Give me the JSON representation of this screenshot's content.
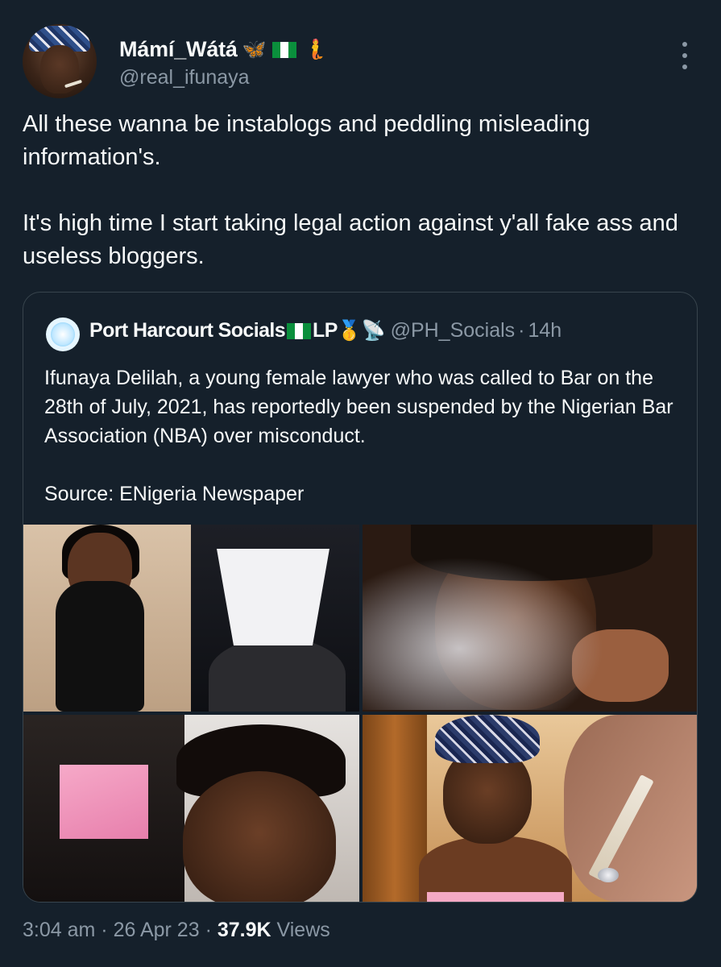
{
  "author": {
    "display_name": "Mámí_Wátá",
    "name_emojis": [
      "🦋",
      "🇳🇬",
      "🧜"
    ],
    "handle": "@real_ifunaya"
  },
  "tweet": {
    "text": "All these wanna be instablogs and peddling misleading information's.\n\nIt's high time I start taking legal action against y'all fake ass and useless bloggers."
  },
  "quoted_tweet": {
    "display_name": "Port Harcourt Socials",
    "name_suffix": "LP",
    "name_emojis": [
      "🥇",
      "📡"
    ],
    "handle": "@PH_Socials",
    "separator": "·",
    "time": "14h",
    "text": "Ifunaya Delilah, a young female lawyer who was called to Bar on the 28th of July, 2021, has reportedly been suspended by the Nigerian Bar Association (NBA) over misconduct.\n\nSource: ENigeria Newspaper",
    "photos": [
      "photo-1",
      "photo-2",
      "photo-3",
      "photo-4"
    ]
  },
  "meta": {
    "time": "3:04 am",
    "sep1": "·",
    "date": "26 Apr 23",
    "sep2": "·",
    "views_count": "37.9K",
    "views_label": "Views"
  },
  "colors": {
    "background": "#15202b",
    "text_primary": "#f7f9f9",
    "text_secondary": "#8b98a5",
    "border": "#38444d"
  }
}
